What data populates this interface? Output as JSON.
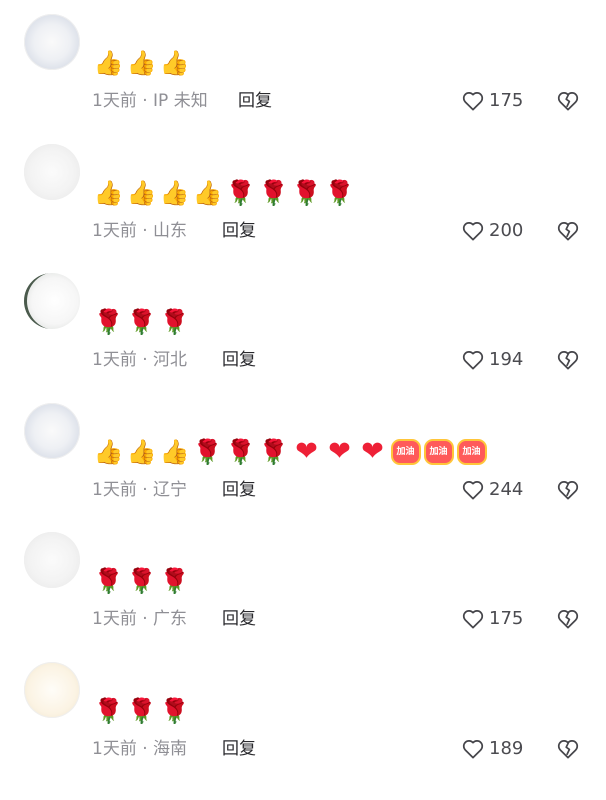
{
  "comments": [
    {
      "username": "",
      "emojis": [
        "thumb",
        "thumb",
        "thumb"
      ],
      "time": "1天前",
      "location": "IP 未知",
      "reply_label": "回复",
      "likes": "175"
    },
    {
      "username": "",
      "emojis": [
        "thumb",
        "thumb",
        "thumb",
        "thumb",
        "rose",
        "rose",
        "rose",
        "rose"
      ],
      "time": "1天前",
      "location": "山东",
      "reply_label": "回复",
      "likes": "200"
    },
    {
      "username": "",
      "emojis": [
        "rose",
        "rose",
        "rose"
      ],
      "time": "1天前",
      "location": "河北",
      "reply_label": "回复",
      "likes": "194"
    },
    {
      "username": "",
      "emojis": [
        "thumb",
        "thumb",
        "thumb",
        "rose",
        "rose",
        "rose",
        "heart",
        "heart",
        "heart",
        "jiayou",
        "jiayou",
        "jiayou"
      ],
      "time": "1天前",
      "location": "辽宁",
      "reply_label": "回复",
      "likes": "244"
    },
    {
      "username": "",
      "emojis": [
        "rose",
        "rose",
        "rose"
      ],
      "time": "1天前",
      "location": "广东",
      "reply_label": "回复",
      "likes": "175"
    },
    {
      "username": "",
      "emojis": [
        "rose",
        "rose",
        "rose"
      ],
      "time": "1天前",
      "location": "海南",
      "reply_label": "回复",
      "likes": "189"
    }
  ],
  "emoji_glyphs": {
    "thumb": "👍",
    "rose": "🌹",
    "heart": "❤",
    "jiayou": "加油"
  },
  "meta_separator": " · ",
  "icons": {
    "like": "heart-outline-icon",
    "dislike": "broken-heart-outline-icon"
  },
  "colors": {
    "meta_text": "#8f8f95",
    "reply_text": "#2a2a2e",
    "count_text": "#4b4b50",
    "heart_emoji": "#ee2036",
    "rose_emoji": "#e23d4b",
    "thumb_emoji": "#f2a900",
    "jiayou_badge": "#ff5a5a"
  }
}
